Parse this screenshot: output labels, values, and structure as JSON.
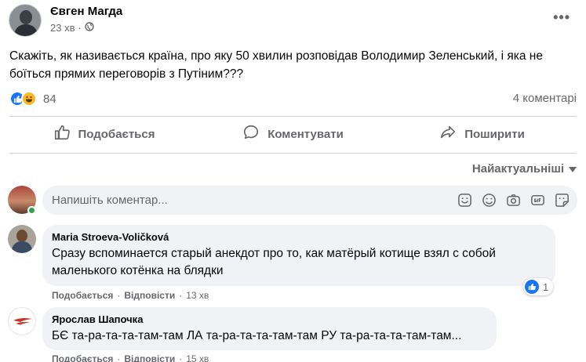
{
  "post": {
    "author": "Євген Магда",
    "time": "23 хв",
    "text": "Скажіть, як називається країна, про яку 50 хвилин розповідав Володимир Зеленський, і яка не боїться прямих переговорів з Путіним???",
    "reactions_count": "84",
    "comments_count": "4 коментарі",
    "menu": "•••"
  },
  "actions": {
    "like": "Подобається",
    "comment": "Коментувати",
    "share": "Поширити"
  },
  "sort_label": "Найактуальніші",
  "composer": {
    "placeholder": "Напишіть коментар..."
  },
  "comments": [
    {
      "author": "Maria Stroeva-Voličková",
      "text": "Сразу вспоминается старый анекдот про то, как матёрый котище взял с собой маленького котёнка на блядки",
      "like_label": "Подобається",
      "reply_label": "Відповісти",
      "time": "13 хв",
      "reaction_count": "1"
    },
    {
      "author": "Ярослав Шапочка",
      "text": "БЄ та-ра-та-та-там-там ЛА та-ра-та-та-там-там РУ та-ра-та-та-там-там...",
      "like_label": "Подобається",
      "reply_label": "Відповісти",
      "time": "15 хв"
    }
  ],
  "separator": "·",
  "colors": {
    "accent": "#1877f2",
    "muted_text": "#65676b",
    "bubble_bg": "#f0f2f5",
    "online": "#31a24c"
  },
  "icons": [
    "globe-icon",
    "more-icon",
    "like-reaction-icon",
    "haha-reaction-icon",
    "thumbs-up-icon",
    "comment-icon",
    "share-icon",
    "chevron-down-icon",
    "sticker-icon",
    "emoji-icon",
    "camera-icon",
    "gif-icon",
    "sticker-2-icon"
  ]
}
